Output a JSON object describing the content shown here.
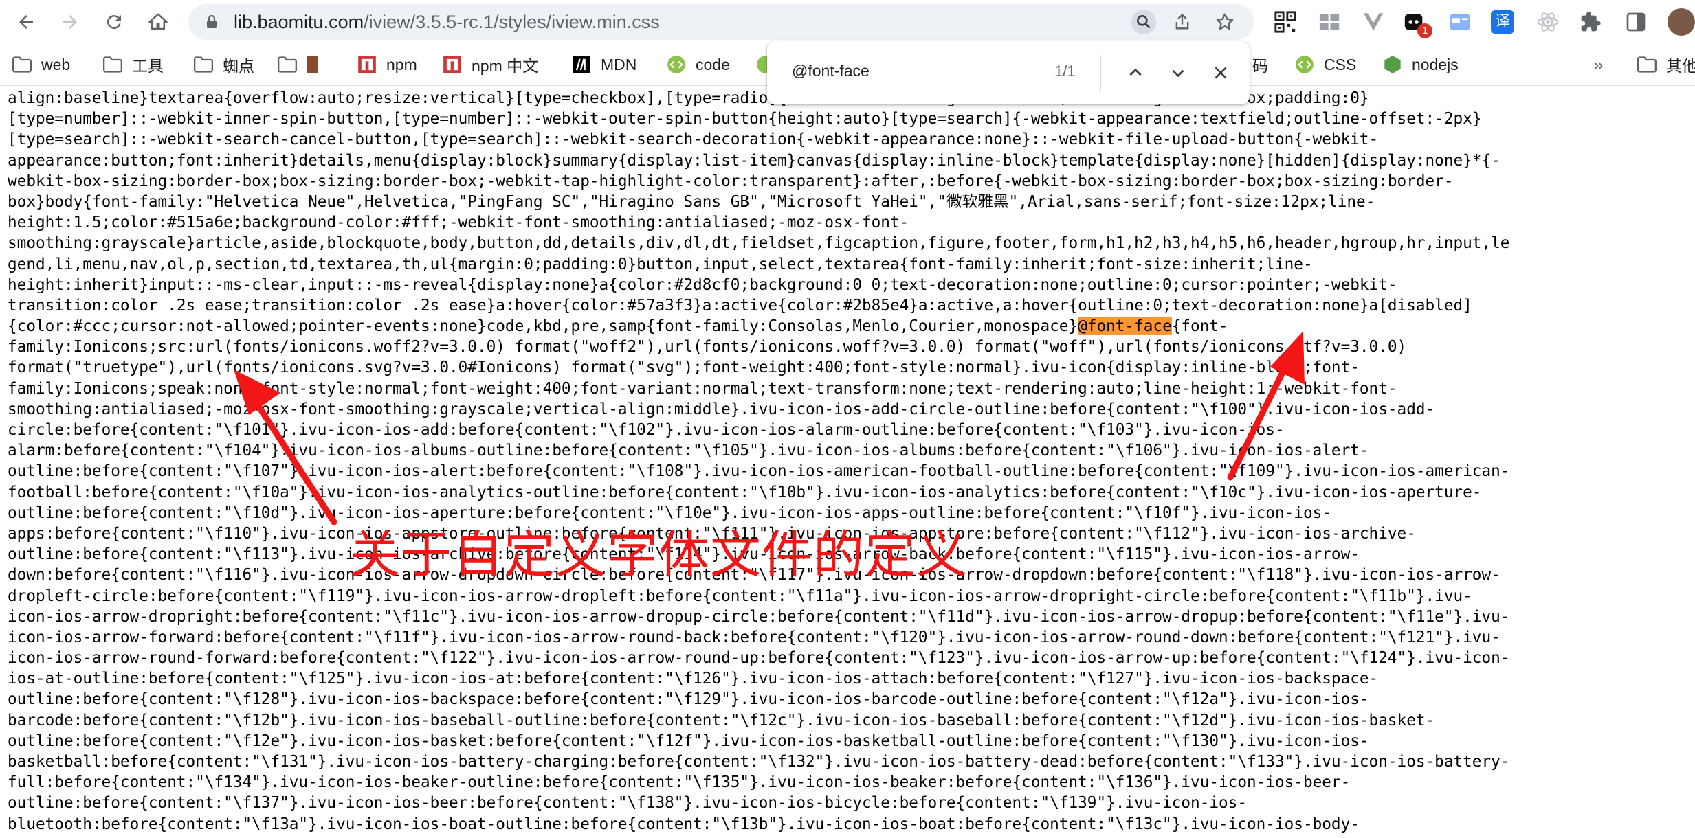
{
  "browser": {
    "url_host": "lib.baomitu.com",
    "url_path": "/iview/3.5.5-rc.1/styles/iview.min.css",
    "extension_badge": "1",
    "extension_translate_label": "译"
  },
  "bookmarks": [
    {
      "label": "web",
      "icon": "folder-icon"
    },
    {
      "label": "工具",
      "icon": "folder-icon"
    },
    {
      "label": "蜘点",
      "icon": "folder-icon"
    },
    {
      "label": "",
      "icon": "folder-icon"
    },
    {
      "label": "npm",
      "icon": "npm-icon"
    },
    {
      "label": "npm 中文",
      "icon": "npm-icon"
    },
    {
      "label": "MDN",
      "icon": "mdn-icon"
    },
    {
      "label": "code",
      "icon": "code-icon"
    },
    {
      "label": "码",
      "icon": "code-icon"
    },
    {
      "label": "CSS",
      "icon": "code-icon"
    },
    {
      "label": "nodejs",
      "icon": "nodejs-icon"
    },
    {
      "label": "其他",
      "icon": "folder-icon"
    }
  ],
  "find": {
    "query": "@font-face",
    "count": "1/1"
  },
  "code": {
    "highlight": "@font-face",
    "lines": [
      "align:baseline}textarea{overflow:auto;resize:vertical}[type=checkbox],[type=radio]{-webkit-box-sizing:border-box;box-sizing:border-box;padding:0}",
      "[type=number]::-webkit-inner-spin-button,[type=number]::-webkit-outer-spin-button{height:auto}[type=search]{-webkit-appearance:textfield;outline-offset:-2px}",
      "[type=search]::-webkit-search-cancel-button,[type=search]::-webkit-search-decoration{-webkit-appearance:none}::-webkit-file-upload-button{-webkit-",
      "appearance:button;font:inherit}details,menu{display:block}summary{display:list-item}canvas{display:inline-block}template{display:none}[hidden]{display:none}*{-",
      "webkit-box-sizing:border-box;box-sizing:border-box;-webkit-tap-highlight-color:transparent}:after,:before{-webkit-box-sizing:border-box;box-sizing:border-",
      "box}body{font-family:\"Helvetica Neue\",Helvetica,\"PingFang SC\",\"Hiragino Sans GB\",\"Microsoft YaHei\",\"微软雅黑\",Arial,sans-serif;font-size:12px;line-",
      "height:1.5;color:#515a6e;background-color:#fff;-webkit-font-smoothing:antialiased;-moz-osx-font-",
      "smoothing:grayscale}article,aside,blockquote,body,button,dd,details,div,dl,dt,fieldset,figcaption,figure,footer,form,h1,h2,h3,h4,h5,h6,header,hgroup,hr,input,le",
      "gend,li,menu,nav,ol,p,section,td,textarea,th,ul{margin:0;padding:0}button,input,select,textarea{font-family:inherit;font-size:inherit;line-",
      "height:inherit}input::-ms-clear,input::-ms-reveal{display:none}a{color:#2d8cf0;background:0 0;text-decoration:none;outline:0;cursor:pointer;-webkit-",
      "transition:color .2s ease;transition:color .2s ease}a:hover{color:#57a3f3}a:active{color:#2b85e4}a:active,a:hover{outline:0;text-decoration:none}a[disabled]",
      "{color:#ccc;cursor:not-allowed;pointer-events:none}code,kbd,pre,samp{font-family:Consolas,Menlo,Courier,monospace}@font-face{font-",
      "family:Ionicons;src:url(fonts/ionicons.woff2?v=3.0.0) format(\"woff2\"),url(fonts/ionicons.woff?v=3.0.0) format(\"woff\"),url(fonts/ionicons.ttf?v=3.0.0)",
      "format(\"truetype\"),url(fonts/ionicons.svg?v=3.0.0#Ionicons) format(\"svg\");font-weight:400;font-style:normal}.ivu-icon{display:inline-block;font-",
      "family:Ionicons;speak:none;font-style:normal;font-weight:400;font-variant:normal;text-transform:none;text-rendering:auto;line-height:1;-webkit-font-",
      "smoothing:antialiased;-moz-osx-font-smoothing:grayscale;vertical-align:middle}.ivu-icon-ios-add-circle-outline:before{content:\"\\f100\"}.ivu-icon-ios-add-",
      "circle:before{content:\"\\f101\"}.ivu-icon-ios-add:before{content:\"\\f102\"}.ivu-icon-ios-alarm-outline:before{content:\"\\f103\"}.ivu-icon-ios-",
      "alarm:before{content:\"\\f104\"}.ivu-icon-ios-albums-outline:before{content:\"\\f105\"}.ivu-icon-ios-albums:before{content:\"\\f106\"}.ivu-icon-ios-alert-",
      "outline:before{content:\"\\f107\"}.ivu-icon-ios-alert:before{content:\"\\f108\"}.ivu-icon-ios-american-football-outline:before{content:\"\\f109\"}.ivu-icon-ios-american-",
      "football:before{content:\"\\f10a\"}.ivu-icon-ios-analytics-outline:before{content:\"\\f10b\"}.ivu-icon-ios-analytics:before{content:\"\\f10c\"}.ivu-icon-ios-aperture-",
      "outline:before{content:\"\\f10d\"}.ivu-icon-ios-aperture:before{content:\"\\f10e\"}.ivu-icon-ios-apps-outline:before{content:\"\\f10f\"}.ivu-icon-ios-",
      "apps:before{content:\"\\f110\"}.ivu-icon-ios-appstore-outline:before{content:\"\\f111\"}.ivu-icon-ios-appstore:before{content:\"\\f112\"}.ivu-icon-ios-archive-",
      "outline:before{content:\"\\f113\"}.ivu-icon-ios-archive:before{content:\"\\f114\"}.ivu-icon-ios-arrow-back:before{content:\"\\f115\"}.ivu-icon-ios-arrow-",
      "down:before{content:\"\\f116\"}.ivu-icon-ios-arrow-dropdown-circle:before{content:\"\\f117\"}.ivu-icon-ios-arrow-dropdown:before{content:\"\\f118\"}.ivu-icon-ios-arrow-",
      "dropleft-circle:before{content:\"\\f119\"}.ivu-icon-ios-arrow-dropleft:before{content:\"\\f11a\"}.ivu-icon-ios-arrow-dropright-circle:before{content:\"\\f11b\"}.ivu-",
      "icon-ios-arrow-dropright:before{content:\"\\f11c\"}.ivu-icon-ios-arrow-dropup-circle:before{content:\"\\f11d\"}.ivu-icon-ios-arrow-dropup:before{content:\"\\f11e\"}.ivu-",
      "icon-ios-arrow-forward:before{content:\"\\f11f\"}.ivu-icon-ios-arrow-round-back:before{content:\"\\f120\"}.ivu-icon-ios-arrow-round-down:before{content:\"\\f121\"}.ivu-",
      "icon-ios-arrow-round-forward:before{content:\"\\f122\"}.ivu-icon-ios-arrow-round-up:before{content:\"\\f123\"}.ivu-icon-ios-arrow-up:before{content:\"\\f124\"}.ivu-icon-",
      "ios-at-outline:before{content:\"\\f125\"}.ivu-icon-ios-at:before{content:\"\\f126\"}.ivu-icon-ios-attach:before{content:\"\\f127\"}.ivu-icon-ios-backspace-",
      "outline:before{content:\"\\f128\"}.ivu-icon-ios-backspace:before{content:\"\\f129\"}.ivu-icon-ios-barcode-outline:before{content:\"\\f12a\"}.ivu-icon-ios-",
      "barcode:before{content:\"\\f12b\"}.ivu-icon-ios-baseball-outline:before{content:\"\\f12c\"}.ivu-icon-ios-baseball:before{content:\"\\f12d\"}.ivu-icon-ios-basket-",
      "outline:before{content:\"\\f12e\"}.ivu-icon-ios-basket:before{content:\"\\f12f\"}.ivu-icon-ios-basketball-outline:before{content:\"\\f130\"}.ivu-icon-ios-",
      "basketball:before{content:\"\\f131\"}.ivu-icon-ios-battery-charging:before{content:\"\\f132\"}.ivu-icon-ios-battery-dead:before{content:\"\\f133\"}.ivu-icon-ios-battery-",
      "full:before{content:\"\\f134\"}.ivu-icon-ios-beaker-outline:before{content:\"\\f135\"}.ivu-icon-ios-beaker:before{content:\"\\f136\"}.ivu-icon-ios-beer-",
      "outline:before{content:\"\\f137\"}.ivu-icon-ios-beer:before{content:\"\\f138\"}.ivu-icon-ios-bicycle:before{content:\"\\f139\"}.ivu-icon-ios-",
      "bluetooth:before{content:\"\\f13a\"}.ivu-icon-ios-boat-outline:before{content:\"\\f13b\"}.ivu-icon-ios-boat:before{content:\"\\f13c\"}.ivu-icon-ios-body-"
    ]
  },
  "annotation": {
    "text": "关于自定义字体文件的定义",
    "color": "#f21616"
  },
  "colors": {
    "highlight": "#ff9632",
    "omnibox_bg": "#eef1f6"
  }
}
